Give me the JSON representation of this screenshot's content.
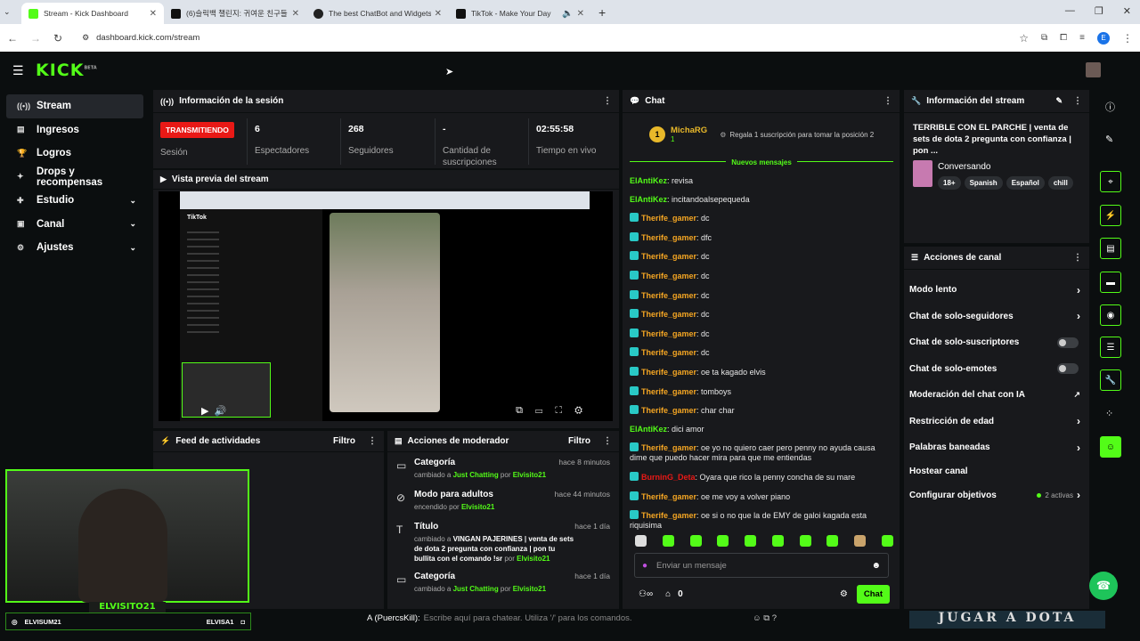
{
  "browser": {
    "tabs": [
      {
        "title": "Stream - Kick Dashboard",
        "fav_color": "#53fc18"
      },
      {
        "title": "(6)슬릭백 챌린지: 귀여운 친구들",
        "fav_color": "#111111"
      },
      {
        "title": "The best ChatBot and Widgets",
        "fav_color": "#222222"
      },
      {
        "title": "TikTok - Make Your Day",
        "fav_color": "#111111"
      }
    ],
    "url": "dashboard.kick.com/stream",
    "profile_initial": "E"
  },
  "app": {
    "logo": "KICK",
    "logo_sup": "BETA"
  },
  "sidebar": {
    "items": [
      {
        "label": "Stream",
        "icon": "((•))"
      },
      {
        "label": "Ingresos",
        "icon": "▤"
      },
      {
        "label": "Logros",
        "icon": "🏆"
      },
      {
        "label": "Drops y recompensas",
        "icon": "✦"
      },
      {
        "label": "Estudio",
        "icon": "✚"
      },
      {
        "label": "Canal",
        "icon": "▣"
      },
      {
        "label": "Ajustes",
        "icon": "⚙"
      }
    ]
  },
  "session": {
    "title": "Información de la sesión",
    "status_badge": "TRANSMITIENDO",
    "status_label": "Sesión",
    "viewers": "6",
    "viewers_label": "Espectadores",
    "followers": "268",
    "followers_label": "Seguidores",
    "subs": "-",
    "subs_label": "Cantidad de suscripciones",
    "time": "02:55:58",
    "time_label": "Tiempo en vivo"
  },
  "preview": {
    "title": "Vista previa del stream",
    "tiktok": "TikTok"
  },
  "chat": {
    "title": "Chat",
    "top_user": "MichaRG",
    "top_count": "1",
    "gift_text": "Regala 1 suscripción para tomar la posición 2",
    "new_messages": "Nuevos mensajes",
    "messages": [
      {
        "user": "ElAntiKez",
        "text": "revisa",
        "color": "#53fc18",
        "badge": false
      },
      {
        "user": "ElAntiKez",
        "text": "incitandoalsepequeda",
        "color": "#53fc18",
        "badge": false
      },
      {
        "user": "Therife_gamer",
        "text": "dc",
        "color": "#f5a623",
        "badge": true
      },
      {
        "user": "Therife_gamer",
        "text": "dfc",
        "color": "#f5a623",
        "badge": true
      },
      {
        "user": "Therife_gamer",
        "text": "dc",
        "color": "#f5a623",
        "badge": true
      },
      {
        "user": "Therife_gamer",
        "text": "dc",
        "color": "#f5a623",
        "badge": true
      },
      {
        "user": "Therife_gamer",
        "text": "dc",
        "color": "#f5a623",
        "badge": true
      },
      {
        "user": "Therife_gamer",
        "text": "dc",
        "color": "#f5a623",
        "badge": true
      },
      {
        "user": "Therife_gamer",
        "text": "dc",
        "color": "#f5a623",
        "badge": true
      },
      {
        "user": "Therife_gamer",
        "text": "dc",
        "color": "#f5a623",
        "badge": true
      },
      {
        "user": "Therife_gamer",
        "text": "oe ta kagado elvis",
        "color": "#f5a623",
        "badge": true
      },
      {
        "user": "Therife_gamer",
        "text": "tomboys",
        "color": "#f5a623",
        "badge": true
      },
      {
        "user": "Therife_gamer",
        "text": "char char",
        "color": "#f5a623",
        "badge": true
      },
      {
        "user": "ElAntiKez",
        "text": "dici amor",
        "color": "#53fc18",
        "badge": false
      },
      {
        "user": "Therife_gamer",
        "text": "oe yo no quiero caer pero penny no ayuda causa dime que puedo hacer mira para que me entiendas",
        "color": "#f5a623",
        "badge": true
      },
      {
        "user": "BurninG_Deta",
        "text": "Oyara que rico la penny concha de su mare",
        "color": "#e91916",
        "badge": true
      },
      {
        "user": "Therife_gamer",
        "text": "oe me voy a volver piano",
        "color": "#f5a623",
        "badge": true
      },
      {
        "user": "Therife_gamer",
        "text": "oe si o no que la de EMY de galoi kagada esta riquisima",
        "color": "#f5a623",
        "badge": true
      }
    ],
    "input_placeholder": "Enviar un mensaje",
    "points": "0",
    "send_label": "Chat"
  },
  "stream_info": {
    "title": "Información del stream",
    "stream_title": "TERRIBLE CON EL PARCHE | venta de sets de dota 2 pregunta con confianza | pon ...",
    "category": "Conversando",
    "tags": [
      "18+",
      "Spanish",
      "Español",
      "chill"
    ]
  },
  "channel_actions": {
    "title": "Acciones de canal",
    "items": [
      {
        "label": "Modo lento",
        "kind": "arrow"
      },
      {
        "label": "Chat de solo-seguidores",
        "kind": "arrow"
      },
      {
        "label": "Chat de solo-suscriptores",
        "kind": "toggle"
      },
      {
        "label": "Chat de solo-emotes",
        "kind": "toggle"
      },
      {
        "label": "Moderación del chat con IA",
        "kind": "external"
      },
      {
        "label": "Restricción de edad",
        "kind": "arrow"
      },
      {
        "label": "Palabras baneadas",
        "kind": "arrow"
      },
      {
        "label": "Hostear canal",
        "kind": "none"
      },
      {
        "label": "Configurar objetivos",
        "kind": "arrow"
      }
    ],
    "goals_active": "2 activas"
  },
  "activity": {
    "title": "Feed de actividades",
    "filter": "Filtro"
  },
  "mod_actions": {
    "title": "Acciones de moderador",
    "filter": "Filtro",
    "items": [
      {
        "title": "Categoría",
        "time": "hace 8 minutos",
        "d1": "cambiado a ",
        "h1": "Just Chatting",
        "d2": " por ",
        "h2": "Elvisito21"
      },
      {
        "title": "Modo para adultos",
        "time": "hace 44 minutos",
        "d1": "encendido por ",
        "h1": "Elvisito21",
        "d2": "",
        "h2": ""
      },
      {
        "title": "Título",
        "time": "hace 1 día",
        "d1": "cambiado a ",
        "h1": "VINGAN PAJERINES | venta de sets de dota 2 pregunta con confianza | pon tu bullita con el comando !sr",
        "d2": " por ",
        "h2": "Elvisito21"
      },
      {
        "title": "Categoría",
        "time": "hace 1 día",
        "d1": "cambiado a ",
        "h1": "Just Chatting",
        "d2": " por ",
        "h2": "Elvisito21"
      }
    ]
  },
  "overlay": {
    "webcam_name": "ELVISITO21",
    "ig_handle": "ELVISUM21",
    "discord_handle": "ELVISA1",
    "game_prompt": "A (PuercsKill):",
    "game_placeholder": "Escribe aquí para chatear. Utiliza '/' para los comandos.",
    "banner": "JUGAR A DOTA"
  },
  "colors": {
    "accent": "#53fc18",
    "live": "#e91916",
    "panel": "#18191c",
    "bg": "#0b0e0f"
  }
}
